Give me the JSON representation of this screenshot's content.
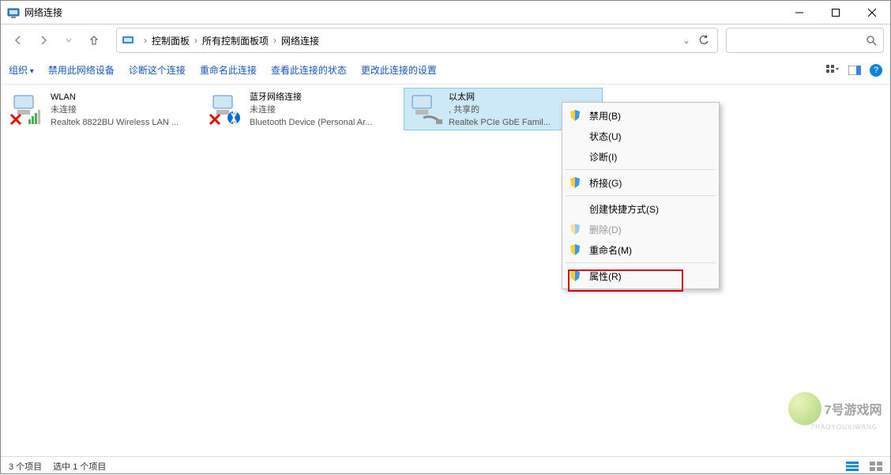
{
  "window": {
    "title": "网络连接"
  },
  "breadcrumb": {
    "root": "控制面板",
    "mid": "所有控制面板项",
    "leaf": "网络连接"
  },
  "toolbar": {
    "organize": "组织",
    "disable": "禁用此网络设备",
    "diagnose": "诊断这个连接",
    "rename": "重命名此连接",
    "status": "查看此连接的状态",
    "settings": "更改此连接的设置"
  },
  "adapters": [
    {
      "name": "WLAN",
      "status": "未连接",
      "device": "Realtek 8822BU Wireless LAN ..."
    },
    {
      "name": "蓝牙网络连接",
      "status": "未连接",
      "device": "Bluetooth Device (Personal Ar..."
    },
    {
      "name": "以太网",
      "status": ", 共享的",
      "device": "Realtek PCIe GbE Famil..."
    }
  ],
  "context_menu": {
    "disable": "禁用(B)",
    "status": "状态(U)",
    "diagnose": "诊断(I)",
    "bridge": "桥接(G)",
    "shortcut": "创建快捷方式(S)",
    "delete": "删除(D)",
    "rename": "重命名(M)",
    "properties": "属性(R)"
  },
  "statusbar": {
    "count": "3 个项目",
    "selected": "选中 1 个项目"
  },
  "watermark": {
    "text": "7号游戏网",
    "sub": "7HAOYOUXIWANG"
  }
}
